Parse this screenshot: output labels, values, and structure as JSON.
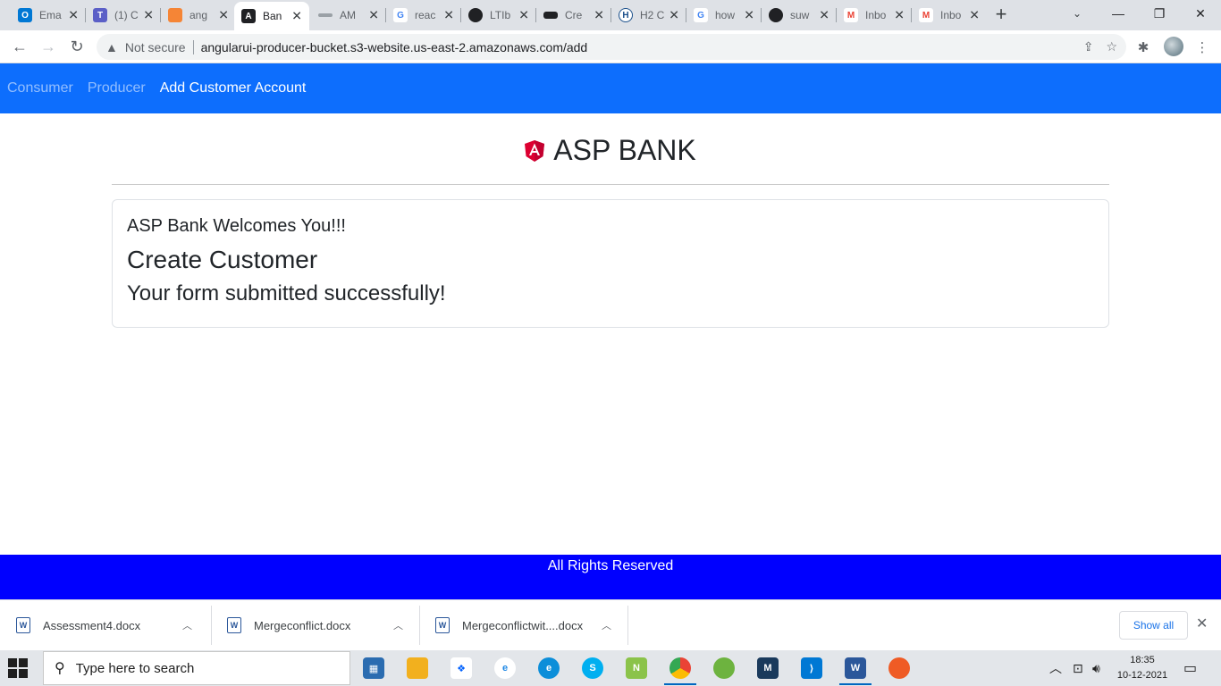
{
  "browser": {
    "tabs": [
      {
        "title": "Ema",
        "favicon": "outlook-icon",
        "color": "#0078d4",
        "glyph": "O",
        "active": false
      },
      {
        "title": "(1) C",
        "favicon": "teams-icon",
        "color": "#5b5fc7",
        "glyph": "T",
        "active": false
      },
      {
        "title": "ang",
        "favicon": "aws-icon",
        "color": "#f58536",
        "glyph": "",
        "active": false
      },
      {
        "title": "Ban",
        "favicon": "angular-icon",
        "color": "#202124",
        "glyph": "A",
        "active": true
      },
      {
        "title": "AM",
        "favicon": "amazon-icon",
        "color": "#9aa0a6",
        "glyph": "",
        "active": false
      },
      {
        "title": "reac",
        "favicon": "google-icon",
        "color": "#4285f4",
        "glyph": "G",
        "active": false
      },
      {
        "title": "LTIb",
        "favicon": "github-icon",
        "color": "#202124",
        "glyph": "",
        "active": false
      },
      {
        "title": "Cre",
        "favicon": "dev-icon",
        "color": "#202124",
        "glyph": "",
        "active": false
      },
      {
        "title": "H2 C",
        "favicon": "h2-icon",
        "color": "#1a4f8b",
        "glyph": "H",
        "active": false
      },
      {
        "title": "how",
        "favicon": "google-icon",
        "color": "#4285f4",
        "glyph": "G",
        "active": false
      },
      {
        "title": "suw",
        "favicon": "github-icon",
        "color": "#202124",
        "glyph": "",
        "active": false
      },
      {
        "title": "Inbo",
        "favicon": "gmail-icon",
        "color": "#ea4335",
        "glyph": "M",
        "active": false
      },
      {
        "title": "Inbo",
        "favicon": "gmail-icon",
        "color": "#ea4335",
        "glyph": "M",
        "active": false
      }
    ],
    "security_label": "Not secure",
    "url": "angularui-producer-bucket.s3-website.us-east-2.amazonaws.com/add"
  },
  "page": {
    "nav": {
      "consumer": "Consumer",
      "producer": "Producer",
      "add_customer": "Add Customer Account"
    },
    "brand_title": "ASP BANK",
    "card": {
      "welcome": "ASP Bank Welcomes You!!!",
      "heading": "Create Customer",
      "message": "Your form submitted successfully!"
    },
    "footer": "All Rights Reserved"
  },
  "downloads": {
    "items": [
      "Assessment4.docx",
      "Mergeconflict.docx",
      "Mergeconflictwit....docx"
    ],
    "show_all": "Show all"
  },
  "taskbar": {
    "search_placeholder": "Type here to search",
    "time": "18:35",
    "date": "10-12-2021"
  },
  "colors": {
    "nav_bg": "#0d6efd",
    "footer_bg": "#0000ff",
    "angular_red": "#dd0031"
  }
}
